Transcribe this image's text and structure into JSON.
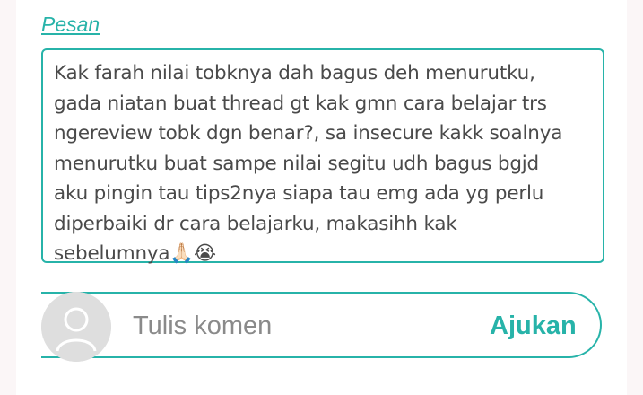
{
  "message_section": {
    "label": "Pesan",
    "text": "Kak farah nilai tobknya dah bagus deh menurutku,\ngada niatan buat thread gt kak gmn cara belajar trs\nngereview tobk dgn benar?, sa insecure kakk soalnya\nmenurutku buat sampe nilai segitu udh bagus bgjd\naku pingin tau tips2nya siapa tau emg ada yg perlu\ndiperbaiki dr cara belajarku, makasihh kak\nsebelumnya🙏🏻😭"
  },
  "comment_bar": {
    "avatar_icon": "user-avatar-placeholder-icon",
    "placeholder": "Tulis komen",
    "submit_label": "Ajukan"
  },
  "colors": {
    "accent": "#27b3a9",
    "text": "#4a4a4a",
    "placeholder": "#8a8a8a",
    "avatar_bg": "#dedede"
  }
}
